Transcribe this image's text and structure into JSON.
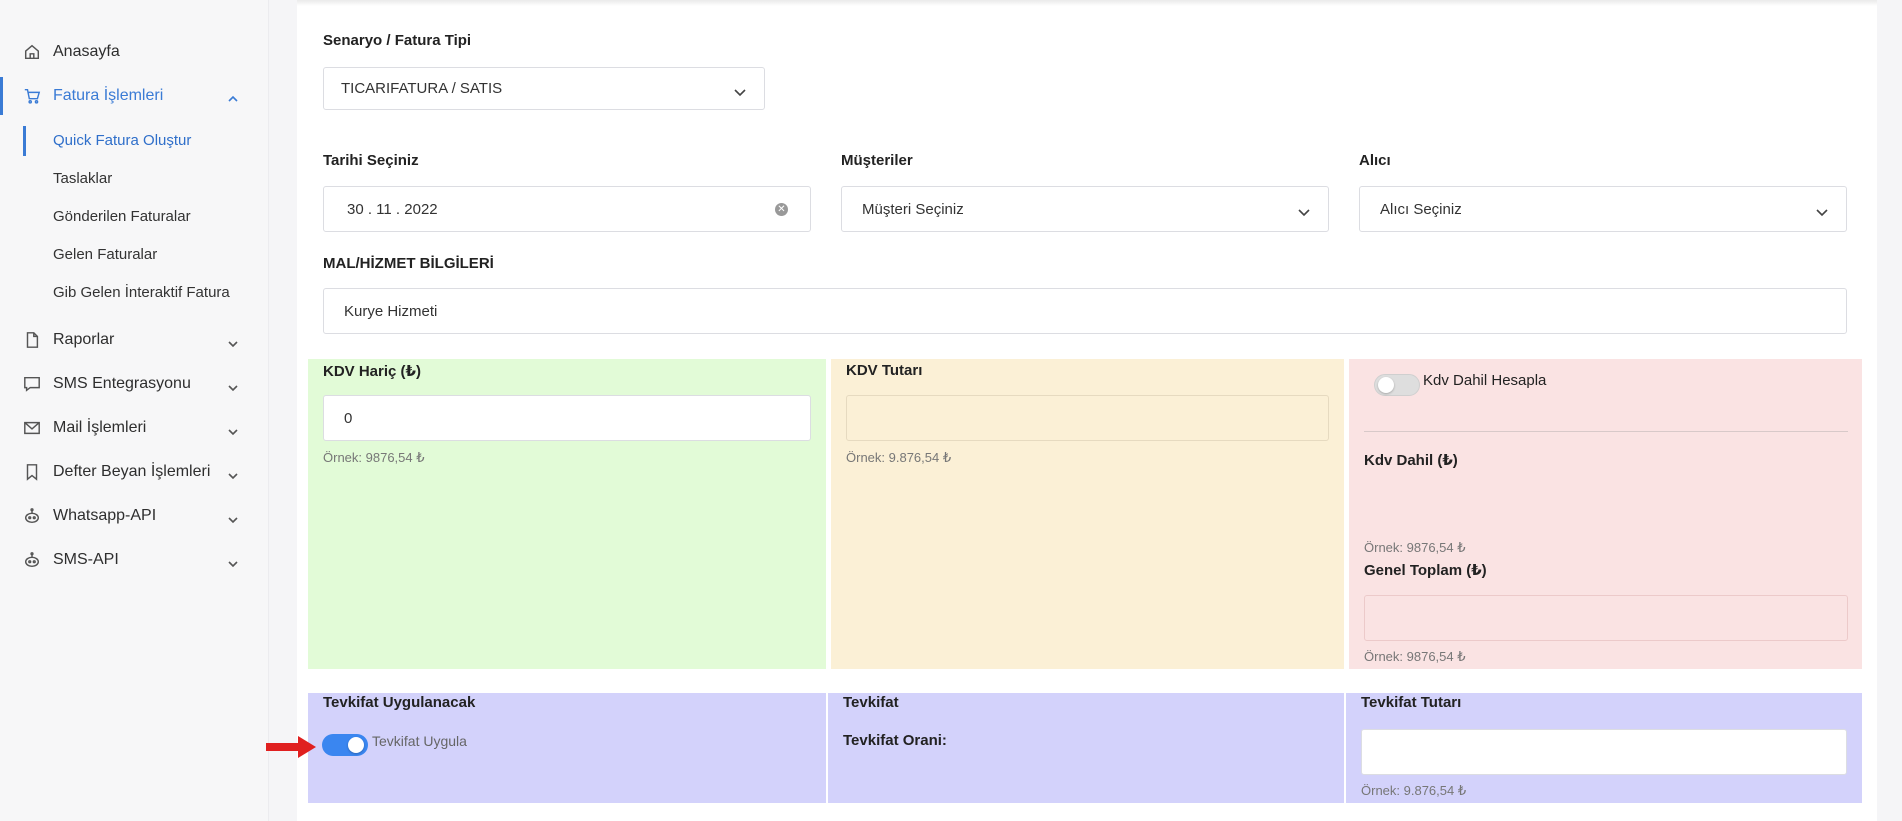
{
  "sidebar": {
    "items": [
      {
        "label": "Anasayfa",
        "icon": "home-icon"
      },
      {
        "label": "Fatura İşlemleri",
        "icon": "cart-icon"
      },
      {
        "label": "Raporlar",
        "icon": "file-icon"
      },
      {
        "label": "SMS Entegrasyonu",
        "icon": "chat-icon"
      },
      {
        "label": "Mail İşlemleri",
        "icon": "mail-icon"
      },
      {
        "label": "Defter Beyan İşlemleri",
        "icon": "bookmark-icon"
      },
      {
        "label": "Whatsapp-API",
        "icon": "robot-icon"
      },
      {
        "label": "SMS-API",
        "icon": "robot-icon"
      }
    ],
    "subitems": [
      {
        "label": "Quick Fatura Oluştur"
      },
      {
        "label": "Taslaklar"
      },
      {
        "label": "Gönderilen Faturalar"
      },
      {
        "label": "Gelen Faturalar"
      },
      {
        "label": "Gib Gelen İnteraktif Fatura"
      }
    ]
  },
  "form": {
    "scenario_label": "Senaryo / Fatura Tipi",
    "scenario_value": "TICARIFATURA / SATIS",
    "date_label": "Tarihi Seçiniz",
    "date_value": "30 . 11 . 2022",
    "customers_label": "Müşteriler",
    "customers_value": "Müşteri Seçiniz",
    "receiver_label": "Alıcı",
    "receiver_value": "Alıcı Seçiniz",
    "goods_label": "MAL/HİZMET BİLGİLERİ",
    "goods_value": "Kurye Hizmeti"
  },
  "panels": {
    "kdv_haric_label": "KDV Hariç (₺)",
    "kdv_haric_value": "0",
    "kdv_haric_hint": "Örnek: 9876,54 ₺",
    "kdv_tutari_label": "KDV Tutarı",
    "kdv_tutari_hint": "Örnek: 9.876,54 ₺",
    "kdv_dahil_toggle_label": "Kdv Dahil Hesapla",
    "kdv_dahil_label": "Kdv Dahil (₺)",
    "kdv_dahil_hint": "Örnek: 9876,54 ₺",
    "genel_toplam_label": "Genel Toplam (₺)",
    "genel_toplam_hint": "Örnek: 9876,54 ₺",
    "tevkifat_uyg_label": "Tevkifat Uygulanacak",
    "tevkifat_toggle_label": "Tevkifat Uygula",
    "tevkifat_label": "Tevkifat",
    "tevkifat_orani_label": "Tevkifat Orani:",
    "tevkifat_tutari_label": "Tevkifat Tutarı",
    "tevkifat_tutari_hint": "Örnek: 9.876,54 ₺"
  },
  "colors": {
    "accent": "#3a7bd5",
    "green_panel": "#e2fbd7",
    "yellow_panel": "#fbf0d6",
    "red_panel": "#fae3e3",
    "purple_panel": "#d3d2fb",
    "arrow": "#e02020"
  }
}
